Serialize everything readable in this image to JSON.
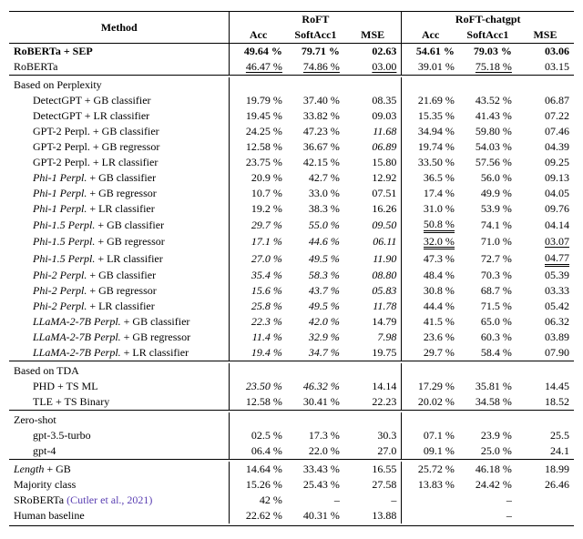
{
  "headers": {
    "method": "Method",
    "group1": "RoFT",
    "group2": "RoFT-chatgpt",
    "acc": "Acc",
    "softacc": "SoftAcc1",
    "mse": "MSE"
  },
  "top_rows": [
    {
      "label": "RoBERTa + SEP",
      "style": "bold",
      "roft": {
        "acc": "49.64 %",
        "softacc": "79.71 %",
        "mse": "02.63"
      },
      "chat": {
        "acc": "54.61 %",
        "softacc": "79.03 %",
        "mse": "03.06"
      },
      "roft_style": {
        "acc": "bold",
        "softacc": "bold",
        "mse": "bold"
      },
      "chat_style": {
        "acc": "bold",
        "softacc": "bold",
        "mse": "bold"
      }
    },
    {
      "label": "RoBERTa",
      "roft": {
        "acc": "46.47 %",
        "softacc": "74.86 %",
        "mse": "03.00"
      },
      "chat": {
        "acc": "39.01 %",
        "softacc": "75.18 %",
        "mse": "03.15"
      },
      "roft_style": {
        "acc": "underline",
        "softacc": "underline",
        "mse": "underline"
      },
      "chat_style": {
        "acc": "",
        "softacc": "underline",
        "mse": ""
      }
    }
  ],
  "perplexity_header": "Based on Perplexity",
  "perplexity_rows": [
    {
      "rich": [
        "",
        "DetectGPT",
        " + GB classifier"
      ],
      "roft": {
        "acc": "19.79 %",
        "softacc": "37.40 %",
        "mse": "08.35"
      },
      "chat": {
        "acc": "21.69 %",
        "softacc": "43.52 %",
        "mse": "06.87"
      }
    },
    {
      "rich": [
        "",
        "DetectGPT",
        " + LR classifier"
      ],
      "roft": {
        "acc": "19.45 %",
        "softacc": "33.82 %",
        "mse": "09.03"
      },
      "chat": {
        "acc": "15.35 %",
        "softacc": "41.43 %",
        "mse": "07.22"
      }
    },
    {
      "rich": [
        "",
        "GPT-2 Perpl.",
        " + GB classifier"
      ],
      "roft": {
        "acc": "24.25 %",
        "softacc": "47.23 %",
        "mse": "11.68"
      },
      "roft_style": {
        "mse": "italic"
      },
      "chat": {
        "acc": "34.94 %",
        "softacc": "59.80 %",
        "mse": "07.46"
      }
    },
    {
      "rich": [
        "",
        "GPT-2 Perpl.",
        " + GB regressor"
      ],
      "roft": {
        "acc": "12.58 %",
        "softacc": "36.67 %",
        "mse": "06.89"
      },
      "roft_style": {
        "mse": "italic"
      },
      "chat": {
        "acc": "19.74 %",
        "softacc": "54.03 %",
        "mse": "04.39"
      }
    },
    {
      "rich": [
        "",
        "GPT-2 Perpl.",
        " + LR classifier"
      ],
      "roft": {
        "acc": "23.75 %",
        "softacc": "42.15 %",
        "mse": "15.80"
      },
      "chat": {
        "acc": "33.50 %",
        "softacc": "57.56 %",
        "mse": "09.25"
      }
    },
    {
      "rich": [
        "italic",
        "Phi-1 Perpl.",
        " + GB classifier"
      ],
      "roft": {
        "acc": "20.9 %",
        "softacc": "42.7 %",
        "mse": "12.92"
      },
      "chat": {
        "acc": "36.5 %",
        "softacc": "56.0 %",
        "mse": "09.13"
      }
    },
    {
      "rich": [
        "italic",
        "Phi-1 Perpl.",
        " + GB regressor"
      ],
      "roft": {
        "acc": "10.7 %",
        "softacc": "33.0 %",
        "mse": "07.51"
      },
      "chat": {
        "acc": "17.4 %",
        "softacc": "49.9 %",
        "mse": "04.05"
      }
    },
    {
      "rich": [
        "italic",
        "Phi-1 Perpl.",
        " + LR classifier"
      ],
      "roft": {
        "acc": "19.2 %",
        "softacc": "38.3 %",
        "mse": "16.26"
      },
      "chat": {
        "acc": "31.0 %",
        "softacc": "53.9 %",
        "mse": "09.76"
      }
    },
    {
      "rich": [
        "italic",
        "Phi-1.5 Perpl.",
        " + GB classifier"
      ],
      "roft": {
        "acc": "29.7 %",
        "softacc": "55.0 %",
        "mse": "09.50"
      },
      "roft_style": {
        "acc": "italic",
        "softacc": "italic",
        "mse": "italic"
      },
      "chat": {
        "acc": "50.8 %",
        "softacc": "74.1 %",
        "mse": "04.14"
      },
      "chat_style": {
        "acc": "dblunder"
      }
    },
    {
      "rich": [
        "italic",
        "Phi-1.5 Perpl.",
        " + GB regressor"
      ],
      "roft": {
        "acc": "17.1 %",
        "softacc": "44.6 %",
        "mse": "06.11"
      },
      "roft_style": {
        "acc": "italic",
        "softacc": "italic",
        "mse": "italic"
      },
      "chat": {
        "acc": "32.0 %",
        "softacc": "71.0 %",
        "mse": "03.07"
      },
      "chat_style": {
        "acc": "dblunder",
        "mse": "underline"
      }
    },
    {
      "rich": [
        "italic",
        "Phi-1.5 Perpl.",
        " + LR classifier"
      ],
      "roft": {
        "acc": "27.0 %",
        "softacc": "49.5 %",
        "mse": "11.90"
      },
      "roft_style": {
        "acc": "italic",
        "softacc": "italic",
        "mse": "italic"
      },
      "chat": {
        "acc": "47.3 %",
        "softacc": "72.7 %",
        "mse": "04.77"
      },
      "chat_style": {
        "mse": "dblunder"
      }
    },
    {
      "rich": [
        "italic",
        "Phi-2 Perpl.",
        " + GB classifier"
      ],
      "roft": {
        "acc": "35.4 %",
        "softacc": "58.3 %",
        "mse": "08.80"
      },
      "roft_style": {
        "acc": "italic",
        "softacc": "italic",
        "mse": "italic"
      },
      "chat": {
        "acc": "48.4 %",
        "softacc": "70.3 %",
        "mse": "05.39"
      }
    },
    {
      "rich": [
        "italic",
        "Phi-2 Perpl.",
        " + GB regressor"
      ],
      "roft": {
        "acc": "15.6 %",
        "softacc": "43.7 %",
        "mse": "05.83"
      },
      "roft_style": {
        "acc": "italic",
        "softacc": "italic",
        "mse": "italic"
      },
      "chat": {
        "acc": "30.8 %",
        "softacc": "68.7 %",
        "mse": "03.33"
      }
    },
    {
      "rich": [
        "italic",
        "Phi-2 Perpl.",
        " + LR classifier"
      ],
      "roft": {
        "acc": "25.8 %",
        "softacc": "49.5 %",
        "mse": "11.78"
      },
      "roft_style": {
        "acc": "italic",
        "softacc": "italic",
        "mse": "italic"
      },
      "chat": {
        "acc": "44.4 %",
        "softacc": "71.5 %",
        "mse": "05.42"
      }
    },
    {
      "rich": [
        "italic",
        "LLaMA-2-7B Perpl.",
        " + GB classifier"
      ],
      "roft": {
        "acc": "22.3 %",
        "softacc": "42.0 %",
        "mse": "14.79"
      },
      "roft_style": {
        "acc": "italic",
        "softacc": "italic"
      },
      "chat": {
        "acc": "41.5 %",
        "softacc": "65.0 %",
        "mse": "06.32"
      }
    },
    {
      "rich": [
        "italic",
        "LLaMA-2-7B Perpl.",
        " + GB regressor"
      ],
      "roft": {
        "acc": "11.4 %",
        "softacc": "32.9 %",
        "mse": "7.98"
      },
      "roft_style": {
        "acc": "italic",
        "softacc": "italic",
        "mse": "italic"
      },
      "chat": {
        "acc": "23.6 %",
        "softacc": "60.3 %",
        "mse": "03.89"
      }
    },
    {
      "rich": [
        "italic",
        "LLaMA-2-7B Perpl.",
        " + LR classifier"
      ],
      "roft": {
        "acc": "19.4 %",
        "softacc": "34.7 %",
        "mse": "19.75"
      },
      "roft_style": {
        "acc": "italic",
        "softacc": "italic"
      },
      "chat": {
        "acc": "29.7 %",
        "softacc": "58.4 %",
        "mse": "07.90"
      }
    }
  ],
  "tda_header": "Based on TDA",
  "tda_rows": [
    {
      "label": "PHD + TS ML",
      "roft": {
        "acc": "23.50 %",
        "softacc": "46.32 %",
        "mse": "14.14"
      },
      "roft_style": {
        "acc": "italic",
        "softacc": "italic"
      },
      "chat": {
        "acc": "17.29 %",
        "softacc": "35.81 %",
        "mse": "14.45"
      }
    },
    {
      "label": "TLE + TS Binary",
      "roft": {
        "acc": "12.58 %",
        "softacc": "30.41 %",
        "mse": "22.23"
      },
      "chat": {
        "acc": "20.02 %",
        "softacc": "34.58 %",
        "mse": "18.52"
      }
    }
  ],
  "zero_header": "Zero-shot",
  "zero_rows": [
    {
      "label": "gpt-3.5-turbo",
      "roft": {
        "acc": "02.5 %",
        "softacc": "17.3 %",
        "mse": "30.3"
      },
      "chat": {
        "acc": "07.1 %",
        "softacc": "23.9 %",
        "mse": "25.5"
      }
    },
    {
      "label": "gpt-4",
      "roft": {
        "acc": "06.4 %",
        "softacc": "22.0 %",
        "mse": "27.0"
      },
      "chat": {
        "acc": "09.1 %",
        "softacc": "25.0 %",
        "mse": "24.1"
      }
    }
  ],
  "bottom_rows": [
    {
      "rich": [
        "italic",
        "Length",
        " + GB"
      ],
      "roft": {
        "acc": "14.64 %",
        "softacc": "33.43 %",
        "mse": "16.55"
      },
      "chat": {
        "acc": "25.72 %",
        "softacc": "46.18 %",
        "mse": "18.99"
      }
    },
    {
      "label": "Majority class",
      "roft": {
        "acc": "15.26 %",
        "softacc": "25.43 %",
        "mse": "27.58"
      },
      "chat": {
        "acc": "13.83 %",
        "softacc": "24.42 %",
        "mse": "26.46"
      }
    },
    {
      "label": "SRoBERTa ",
      "cite": "(Cutler et al., 2021)",
      "roft": {
        "acc": "42 %",
        "softacc": "–",
        "mse": "–"
      },
      "chat": {
        "acc": "",
        "softacc": "–",
        "mse": ""
      }
    },
    {
      "label": "Human baseline",
      "roft": {
        "acc": "22.62 %",
        "softacc": "40.31 %",
        "mse": "13.88"
      },
      "chat": {
        "acc": "",
        "softacc": "–",
        "mse": ""
      }
    }
  ]
}
